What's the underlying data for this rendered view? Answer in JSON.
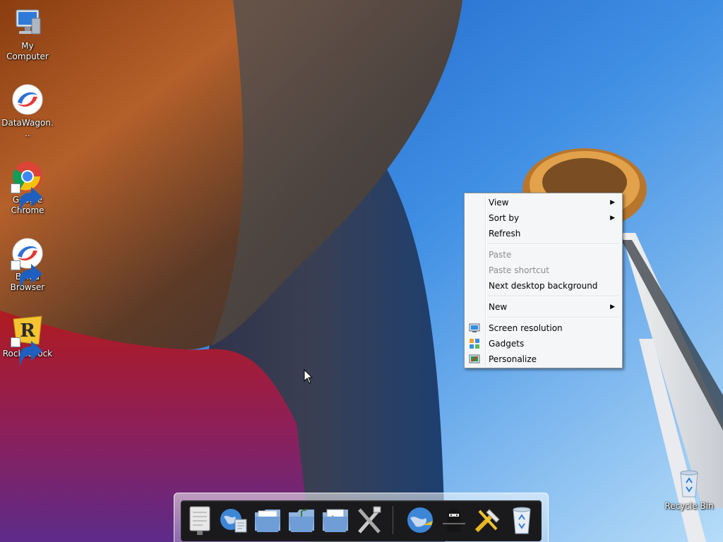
{
  "desktop": {
    "icons": [
      {
        "label": "My Computer",
        "icon": "computer-icon",
        "shortcut": false
      },
      {
        "label": "DataWagon...",
        "icon": "datawagon-icon",
        "shortcut": false
      },
      {
        "label": "Google Chrome",
        "icon": "chrome-icon",
        "shortcut": true
      },
      {
        "label": "Baidu Browser",
        "icon": "baidu-browser-icon",
        "shortcut": true
      },
      {
        "label": "RocketDock",
        "icon": "rocketdock-icon",
        "shortcut": true
      }
    ],
    "recycle_bin": {
      "label": "Recycle Bin",
      "icon": "recycle-bin-icon"
    }
  },
  "context_menu": {
    "view": "View",
    "sort_by": "Sort by",
    "refresh": "Refresh",
    "paste": "Paste",
    "paste_shortcut": "Paste shortcut",
    "next_background": "Next desktop background",
    "new": "New",
    "screen_resolution": "Screen resolution",
    "gadgets": "Gadgets",
    "personalize": "Personalize"
  },
  "dock": {
    "items": [
      "notepad-icon",
      "internet-globe-icon",
      "documents-folder-icon",
      "music-folder-icon",
      "pictures-folder-icon",
      "system-tools-icon",
      "network-globe-icon",
      "ninja-icon",
      "tools-icon",
      "recycle-bin-icon"
    ]
  },
  "colors": {
    "menu_bg": "#f5f6f7",
    "menu_disabled": "#8d8d8d",
    "sky": "#3b8ae6"
  }
}
